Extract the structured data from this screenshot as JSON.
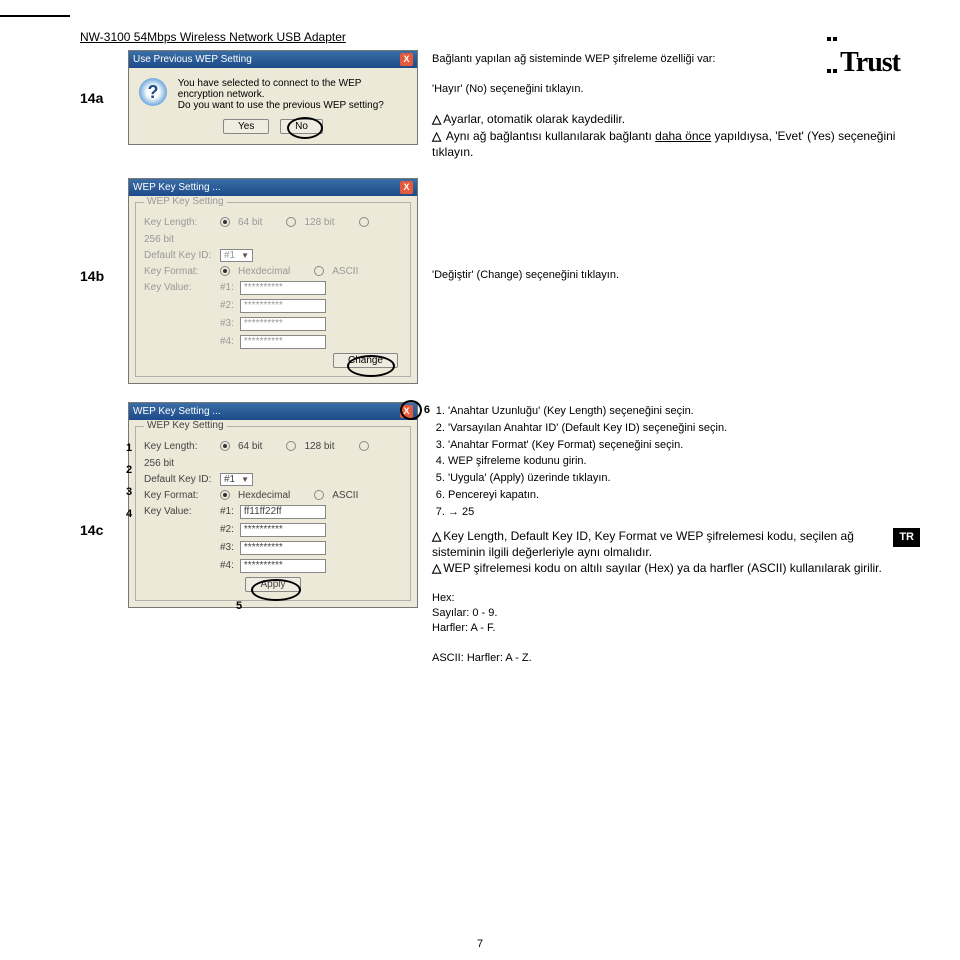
{
  "header": {
    "title": "NW-3100 54Mbps Wireless Network USB Adapter",
    "brand": "Trust"
  },
  "step14a": {
    "label": "14a",
    "dialog": {
      "title": "Use Previous WEP Setting",
      "line1": "You have selected to connect to the WEP encryption network.",
      "line2": "Do you want to use the previous WEP setting?",
      "yes": "Yes",
      "no": "No"
    },
    "desc": {
      "intro": "Bağlantı yapılan ağ sisteminde WEP şifreleme özelliği var:",
      "action": "'Hayır' (No) seçeneğini tıklayın.",
      "warn1": "Ayarlar, otomatik olarak kaydedilir.",
      "warn2a": "Aynı ağ bağlantısı kullanılarak bağlantı ",
      "warn2u": "daha önce",
      "warn2b": " yapıldıysa, 'Evet' (Yes) seçeneğini tıklayın."
    }
  },
  "step14b": {
    "label": "14b",
    "panel": {
      "title": "WEP Key Setting ...",
      "legend": "WEP Key Setting",
      "keyLengthLabel": "Key Length:",
      "kl64": "64 bit",
      "kl128": "128 bit",
      "kl256": "256 bit",
      "defaultKeyIdLabel": "Default Key ID:",
      "defaultKeyIdVal": "#1",
      "keyFormatLabel": "Key Format:",
      "kfHex": "Hexdecimal",
      "kfAscii": "ASCII",
      "keyValueLabel": "Key Value:",
      "kv1": "#1:",
      "kv2": "#2:",
      "kv3": "#3:",
      "kv4": "#4:",
      "kvMask": "**********",
      "change": "Change"
    },
    "descAction": "'Değiştir' (Change) seçeneğini tıklayın."
  },
  "step14c": {
    "label": "14c",
    "panel": {
      "title": "WEP Key Setting ...",
      "legend": "WEP Key Setting",
      "keyLengthLabel": "Key Length:",
      "kl64": "64 bit",
      "kl128": "128 bit",
      "kl256": "256 bit",
      "defaultKeyIdLabel": "Default Key ID:",
      "defaultKeyIdVal": "#1",
      "keyFormatLabel": "Key Format:",
      "kfHex": "Hexdecimal",
      "kfAscii": "ASCII",
      "keyValueLabel": "Key Value:",
      "kv1": "#1:",
      "kv2": "#2:",
      "kv3": "#3:",
      "kv4": "#4:",
      "kvVal1": "ff11ff22ff",
      "kvMask": "**********",
      "apply": "Apply"
    },
    "callouts": {
      "c1": "1",
      "c2": "2",
      "c3": "3",
      "c4": "4",
      "c5": "5",
      "c6": "6"
    },
    "list": {
      "i1": "'Anahtar Uzunluğu' (Key Length) seçeneğini seçin.",
      "i2": "'Varsayılan Anahtar ID' (Default Key ID) seçeneğini seçin.",
      "i3": "'Anahtar Format' (Key Format) seçeneğini seçin.",
      "i4": "WEP şifreleme kodunu girin.",
      "i5": "'Uygula' (Apply) üzerinde tıklayın.",
      "i6": "Pencereyi kapatın.",
      "i7": "→ 25"
    },
    "warnA": "Key Length, Default Key ID, Key Format ve WEP şifrelemesi kodu, seçilen ağ sisteminin ilgili değerleriyle aynı olmalıdır.",
    "warnB": "WEP şifrelemesi kodu on altılı sayılar (Hex) ya da harfler (ASCII) kullanılarak girilir.",
    "hex": "Hex:",
    "hexNums": "Sayılar:  0 - 9.",
    "hexLetters": "Harfler:  A - F.",
    "ascii": "ASCII: Harfler: A - Z.",
    "trBadge": "TR"
  },
  "pagenum": "7"
}
